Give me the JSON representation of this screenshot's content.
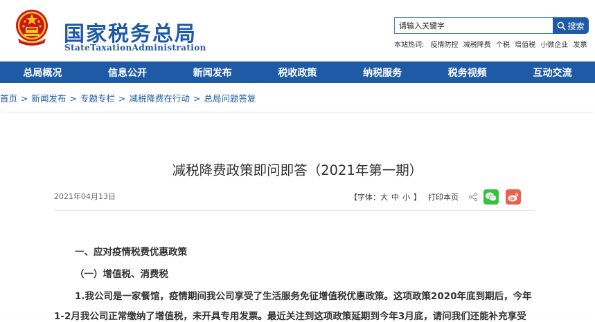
{
  "site": {
    "logo_cn": "国家税务总局",
    "logo_en": "StateTaxationAdministration",
    "brand_color": "#1f5aa6"
  },
  "search": {
    "placeholder": "请输入关键字",
    "button_label": "搜索",
    "hot_label": "本站热词:",
    "hot_terms": [
      "疫情防控",
      "减税降费",
      "个税",
      "增值税",
      "小微企业",
      "发票"
    ]
  },
  "nav": {
    "items": [
      "总局概况",
      "信息公开",
      "新闻发布",
      "税收政策",
      "纳税服务",
      "税务视频",
      "互动交流"
    ]
  },
  "breadcrumb": {
    "items": [
      "首页",
      "新闻发布",
      "专题专栏",
      "减税降费在行动",
      "总局问题答复"
    ],
    "separator": ">"
  },
  "article": {
    "title": "减税降费政策即问即答（2021年第一期）",
    "date": "2021年04月13日",
    "font_label": "【字体：",
    "font_large": "大",
    "font_medium": "中",
    "font_small": "小",
    "font_close": "】",
    "print_label": "打印本页",
    "share_colors": {
      "wechat": "#33c33f",
      "weibo": "#e9614f"
    },
    "heading_1": "一、应对疫情税费优惠政策",
    "heading_2": "（一）增值税、消费税",
    "para_1_line_1": "1.我公司是一家餐馆，疫情期间我公司享受了生活服务免征增值税优惠政策。这项政策2020年底到期后，今年",
    "para_1_line_2": "1-2月我公司正常缴纳了增值税，未开具专用发票。最近关注到这项政策延期到今年3月底，请问我们还能补充享受"
  }
}
